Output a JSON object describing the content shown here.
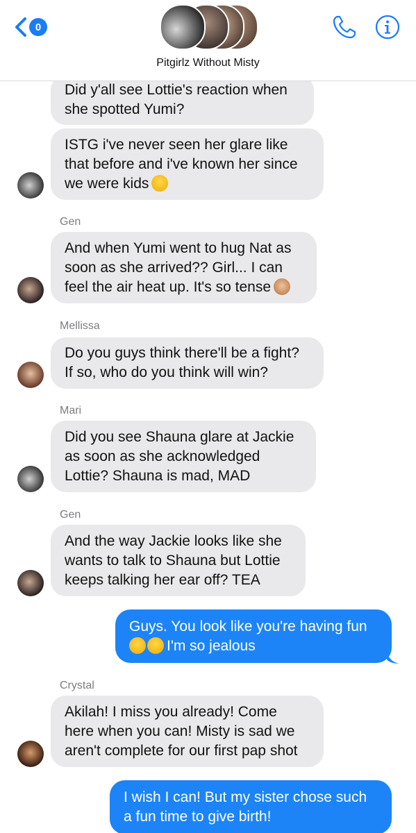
{
  "header": {
    "back_count": "0",
    "title": "Pitgirlz Without Misty",
    "icons": [
      "back-chevron-icon",
      "phone-icon",
      "info-icon"
    ],
    "accent": "#1a7cf6"
  },
  "colors": {
    "incoming": "#e9e9eb",
    "outgoing": "#1c84f6",
    "sender_name": "#7d7d82"
  },
  "messages": [
    {
      "dir": "in",
      "lines": [
        "Did y'all see Lottie's reaction when",
        "she spotted Yumi?"
      ]
    },
    {
      "dir": "in",
      "lines": [
        "ISTG i've never seen her glare like",
        "that before and i've known her since",
        "we were kids"
      ],
      "emoji": "loudly-crying-face"
    },
    {
      "sender": "Gen"
    },
    {
      "dir": "in",
      "lines": [
        "And when Yumi went to hug Nat as",
        "soon as she arrived?? Girl... I can",
        "feel the air heat up. It's so tense"
      ],
      "emoji": "see-no-evil-monkey"
    },
    {
      "sender": "Mellissa"
    },
    {
      "dir": "in",
      "lines": [
        "Do you guys think there'll be a fight?",
        "If so, who do you think will win?"
      ]
    },
    {
      "sender": "Mari"
    },
    {
      "dir": "in",
      "lines": [
        "Did you see Shauna glare at Jackie",
        "as soon as she acknowledged",
        "Lottie? Shauna is mad, MAD"
      ]
    },
    {
      "sender": "Gen"
    },
    {
      "dir": "in",
      "lines": [
        "And the way Jackie looks like she",
        "wants to talk to Shauna but Lottie",
        "keeps talking her ear off? TEA"
      ]
    },
    {
      "dir": "out",
      "lines": [
        "Guys. You look like you're having fun",
        "I'm so jealous"
      ],
      "emoji": "loudly-crying-face x2"
    },
    {
      "sender": "Crystal"
    },
    {
      "dir": "in",
      "lines": [
        "Akilah! I miss you already! Come",
        "here when you can! Misty is sad we",
        "aren't complete for our first pap shot"
      ]
    },
    {
      "dir": "out",
      "lines": [
        "I wish I can! But my sister chose such",
        "a fun time to give birth!"
      ]
    }
  ]
}
